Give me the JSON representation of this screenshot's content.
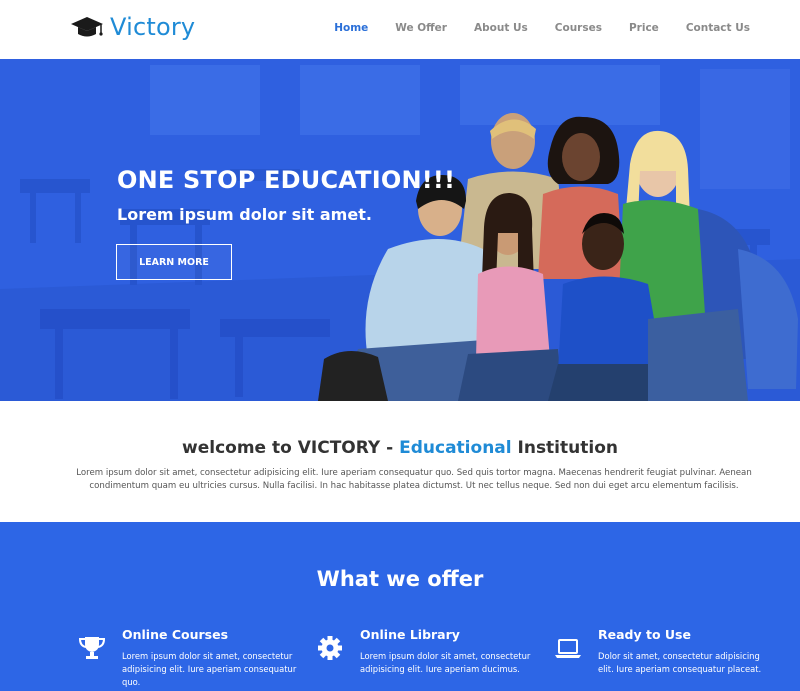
{
  "brand": {
    "name": "Victory",
    "logo_icon": "graduation-cap-icon",
    "color": "#1f8bd6"
  },
  "nav": {
    "items": [
      {
        "label": "Home",
        "active": true
      },
      {
        "label": "We Offer",
        "active": false
      },
      {
        "label": "About Us",
        "active": false
      },
      {
        "label": "Courses",
        "active": false
      },
      {
        "label": "Price",
        "active": false
      },
      {
        "label": "Contact Us",
        "active": false
      }
    ],
    "active_color": "#2a6fd8"
  },
  "hero": {
    "title": "ONE STOP EDUCATION!!!",
    "subtitle": "Lorem ipsum dolor sit amet.",
    "button_label": "LEARN MORE",
    "background_color": "#2f60e0"
  },
  "welcome": {
    "title_prefix": "welcome to ",
    "title_brand": "VICTORY",
    "title_sep": " - ",
    "title_accent": "Educational",
    "title_suffix": " Institution",
    "text": "Lorem ipsum dolor sit amet, consectetur adipisicing elit. Iure aperiam consequatur quo. Sed quis tortor magna. Maecenas hendrerit feugiat pulvinar. Aenean condimentum quam eu ultricies cursus. Nulla facilisi. In hac habitasse platea dictumst. Ut nec tellus neque. Sed non dui eget arcu elementum facilisis."
  },
  "offer": {
    "title": "What we offer",
    "background_color": "#2d66e6",
    "items": [
      {
        "icon": "trophy-icon",
        "heading": "Online Courses",
        "text": "Lorem ipsum dolor sit amet, consectetur adipisicing elit. Iure aperiam consequatur quo."
      },
      {
        "icon": "gear-icon",
        "heading": "Online Library",
        "text": "Lorem ipsum dolor sit amet, consectetur adipisicing elit. Iure aperiam ducimus."
      },
      {
        "icon": "laptop-icon",
        "heading": "Ready to Use",
        "text": "Dolor sit amet, consectetur adipisicing elit. Iure aperiam consequatur placeat."
      }
    ]
  }
}
